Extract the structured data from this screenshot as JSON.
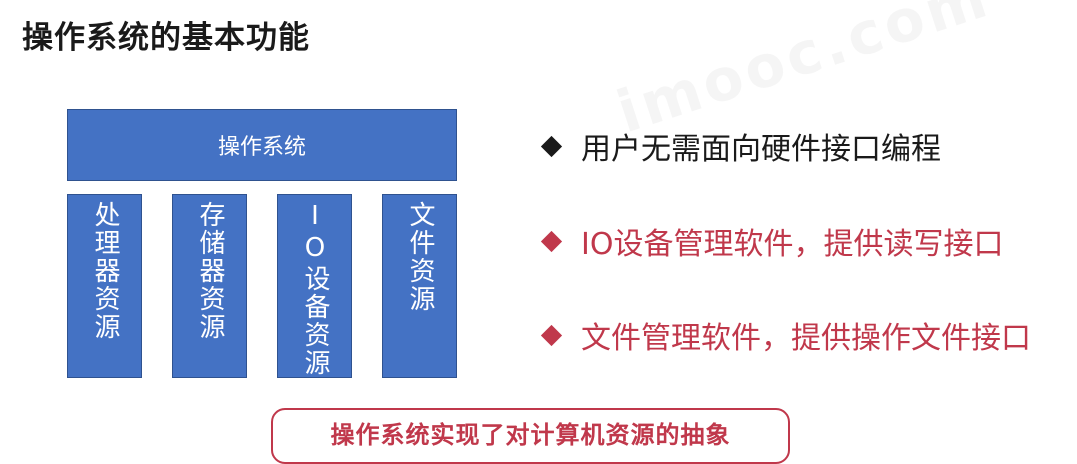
{
  "title": "操作系统的基本功能",
  "watermark": "imooc.com",
  "os_label": "操作系统",
  "resources": [
    "处理器资源",
    "存储器资源",
    "IO设备资源",
    "文件资源"
  ],
  "bullets": [
    {
      "text": "用户无需面向硬件接口编程",
      "color": "#1a1a1a"
    },
    {
      "text": "IO设备管理软件，提供读写接口",
      "color": "#c0384b"
    },
    {
      "text": "文件管理软件，提供操作文件接口",
      "color": "#c0384b"
    }
  ],
  "summary": "操作系统实现了对计算机资源的抽象",
  "colors": {
    "box_fill": "#4472c4",
    "accent": "#c0384b"
  }
}
